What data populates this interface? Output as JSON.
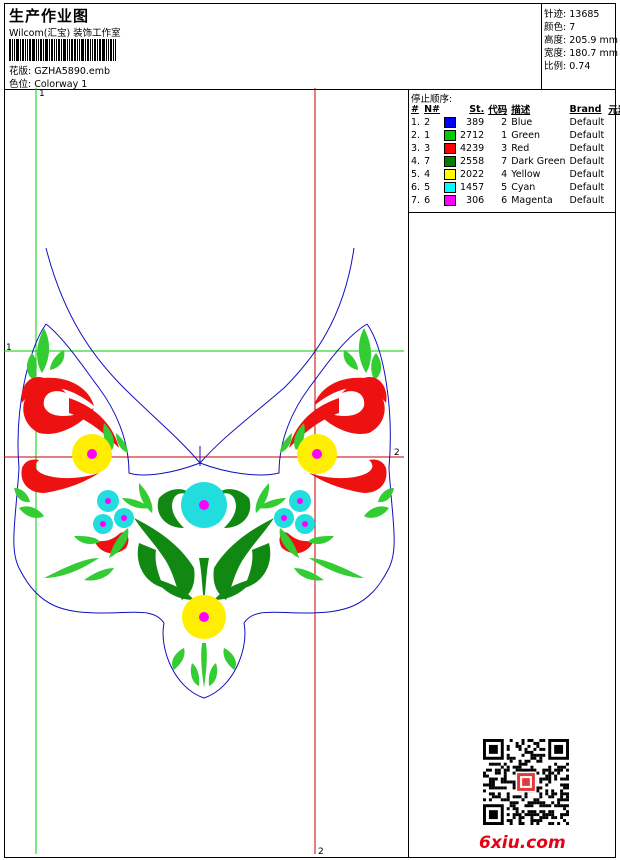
{
  "header": {
    "title": "生产作业图",
    "subtitle": "Wilcom(汇宝) 装饰工作室",
    "design_file": "花版:  GZHA5890.emb",
    "colorway": "色位:  Colorway 1"
  },
  "stats": [
    {
      "label": "针迹:",
      "value": "13685"
    },
    {
      "label": "颜色:",
      "value": "7"
    },
    {
      "label": "高度:",
      "value": "205.9 mm"
    },
    {
      "label": "宽度:",
      "value": "180.7 mm"
    },
    {
      "label": "比例:",
      "value": "0.74"
    }
  ],
  "stop_sequence": {
    "title": "停止顺序:",
    "columns": [
      "#",
      "N#",
      "St.",
      "代码",
      "描述",
      "Brand",
      "元素"
    ],
    "rows": [
      {
        "idx": "1.",
        "n": "2",
        "color": "#0000ff",
        "stitches": "389",
        "code": "2",
        "desc": "Blue",
        "brand": "Default"
      },
      {
        "idx": "2.",
        "n": "1",
        "color": "#00cc00",
        "stitches": "2712",
        "code": "1",
        "desc": "Green",
        "brand": "Default"
      },
      {
        "idx": "3.",
        "n": "3",
        "color": "#ff0000",
        "stitches": "4239",
        "code": "3",
        "desc": "Red",
        "brand": "Default"
      },
      {
        "idx": "4.",
        "n": "7",
        "color": "#008000",
        "stitches": "2558",
        "code": "7",
        "desc": "Dark Green",
        "brand": "Default"
      },
      {
        "idx": "5.",
        "n": "4",
        "color": "#ffff00",
        "stitches": "2022",
        "code": "4",
        "desc": "Yellow",
        "brand": "Default"
      },
      {
        "idx": "6.",
        "n": "5",
        "color": "#00ffff",
        "stitches": "1457",
        "code": "5",
        "desc": "Cyan",
        "brand": "Default"
      },
      {
        "idx": "7.",
        "n": "6",
        "color": "#ff00ff",
        "stitches": "306",
        "code": "6",
        "desc": "Magenta",
        "brand": "Default"
      }
    ]
  },
  "guides": {
    "v_left_label": "1",
    "h_top_label": "1",
    "h_mid_label": "2",
    "v_right_label": "2"
  },
  "watermark": "6xiu.com",
  "colors": {
    "outline": "#1010c0",
    "guide_green": "#00cc00",
    "guide_red": "#cc0000"
  }
}
